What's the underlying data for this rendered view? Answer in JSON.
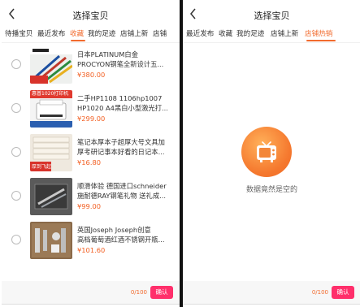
{
  "left_panel": {
    "title": "选择宝贝",
    "tabs": [
      "待播宝贝",
      "最近发布",
      "收藏",
      "我的足迹",
      "店铺上新",
      "店铺"
    ],
    "active_tab": "收藏",
    "products": [
      {
        "name_line1": "日本PLATINUM白金",
        "name_line2": "PROCYON钢笔全新设计五...",
        "price": "¥380.00",
        "thumb_icon": "fountain-pens-image"
      },
      {
        "name_line1": "二手HP1108 1106hp1007",
        "name_line2": "HP1020 A4黑白小型激光打...",
        "price": "¥299.00",
        "thumb_icon": "laser-printer-image",
        "thumb_badge": "惠普1020打印机"
      },
      {
        "name_line1": "笔记本厚本子超厚大号文具加",
        "name_line2": "厚考研记事本好看的日记本...",
        "price": "¥16.80",
        "thumb_icon": "notebook-stack-image",
        "thumb_badge": "厚到飞起"
      },
      {
        "name_line1": "顺滑体验 德国进口schneider",
        "name_line2": "施耐德RAY钢笔礼物 送礼成...",
        "price": "¥99.00",
        "thumb_icon": "pen-gift-box-image"
      },
      {
        "name_line1": "英国Joseph Joseph创意",
        "name_line2": "高档葡萄酒红酒不锈钢开瓶...",
        "price": "¥101.60",
        "thumb_icon": "wine-opener-set-image"
      }
    ],
    "footer": {
      "count": "0/100",
      "confirm": "确认"
    }
  },
  "right_panel": {
    "title": "选择宝贝",
    "tabs": [
      "最近发布",
      "收藏",
      "我的足迹",
      "店铺上新",
      "店铺热销"
    ],
    "active_tab": "店铺热销",
    "empty_icon": "tv-icon",
    "empty_text": "数据竟然是空的",
    "footer": {
      "count": "0/100",
      "confirm": "确认"
    }
  },
  "colors": {
    "accent": "#f26b2e",
    "price": "#f25f22",
    "confirm_bg": "#ff2f6b"
  }
}
